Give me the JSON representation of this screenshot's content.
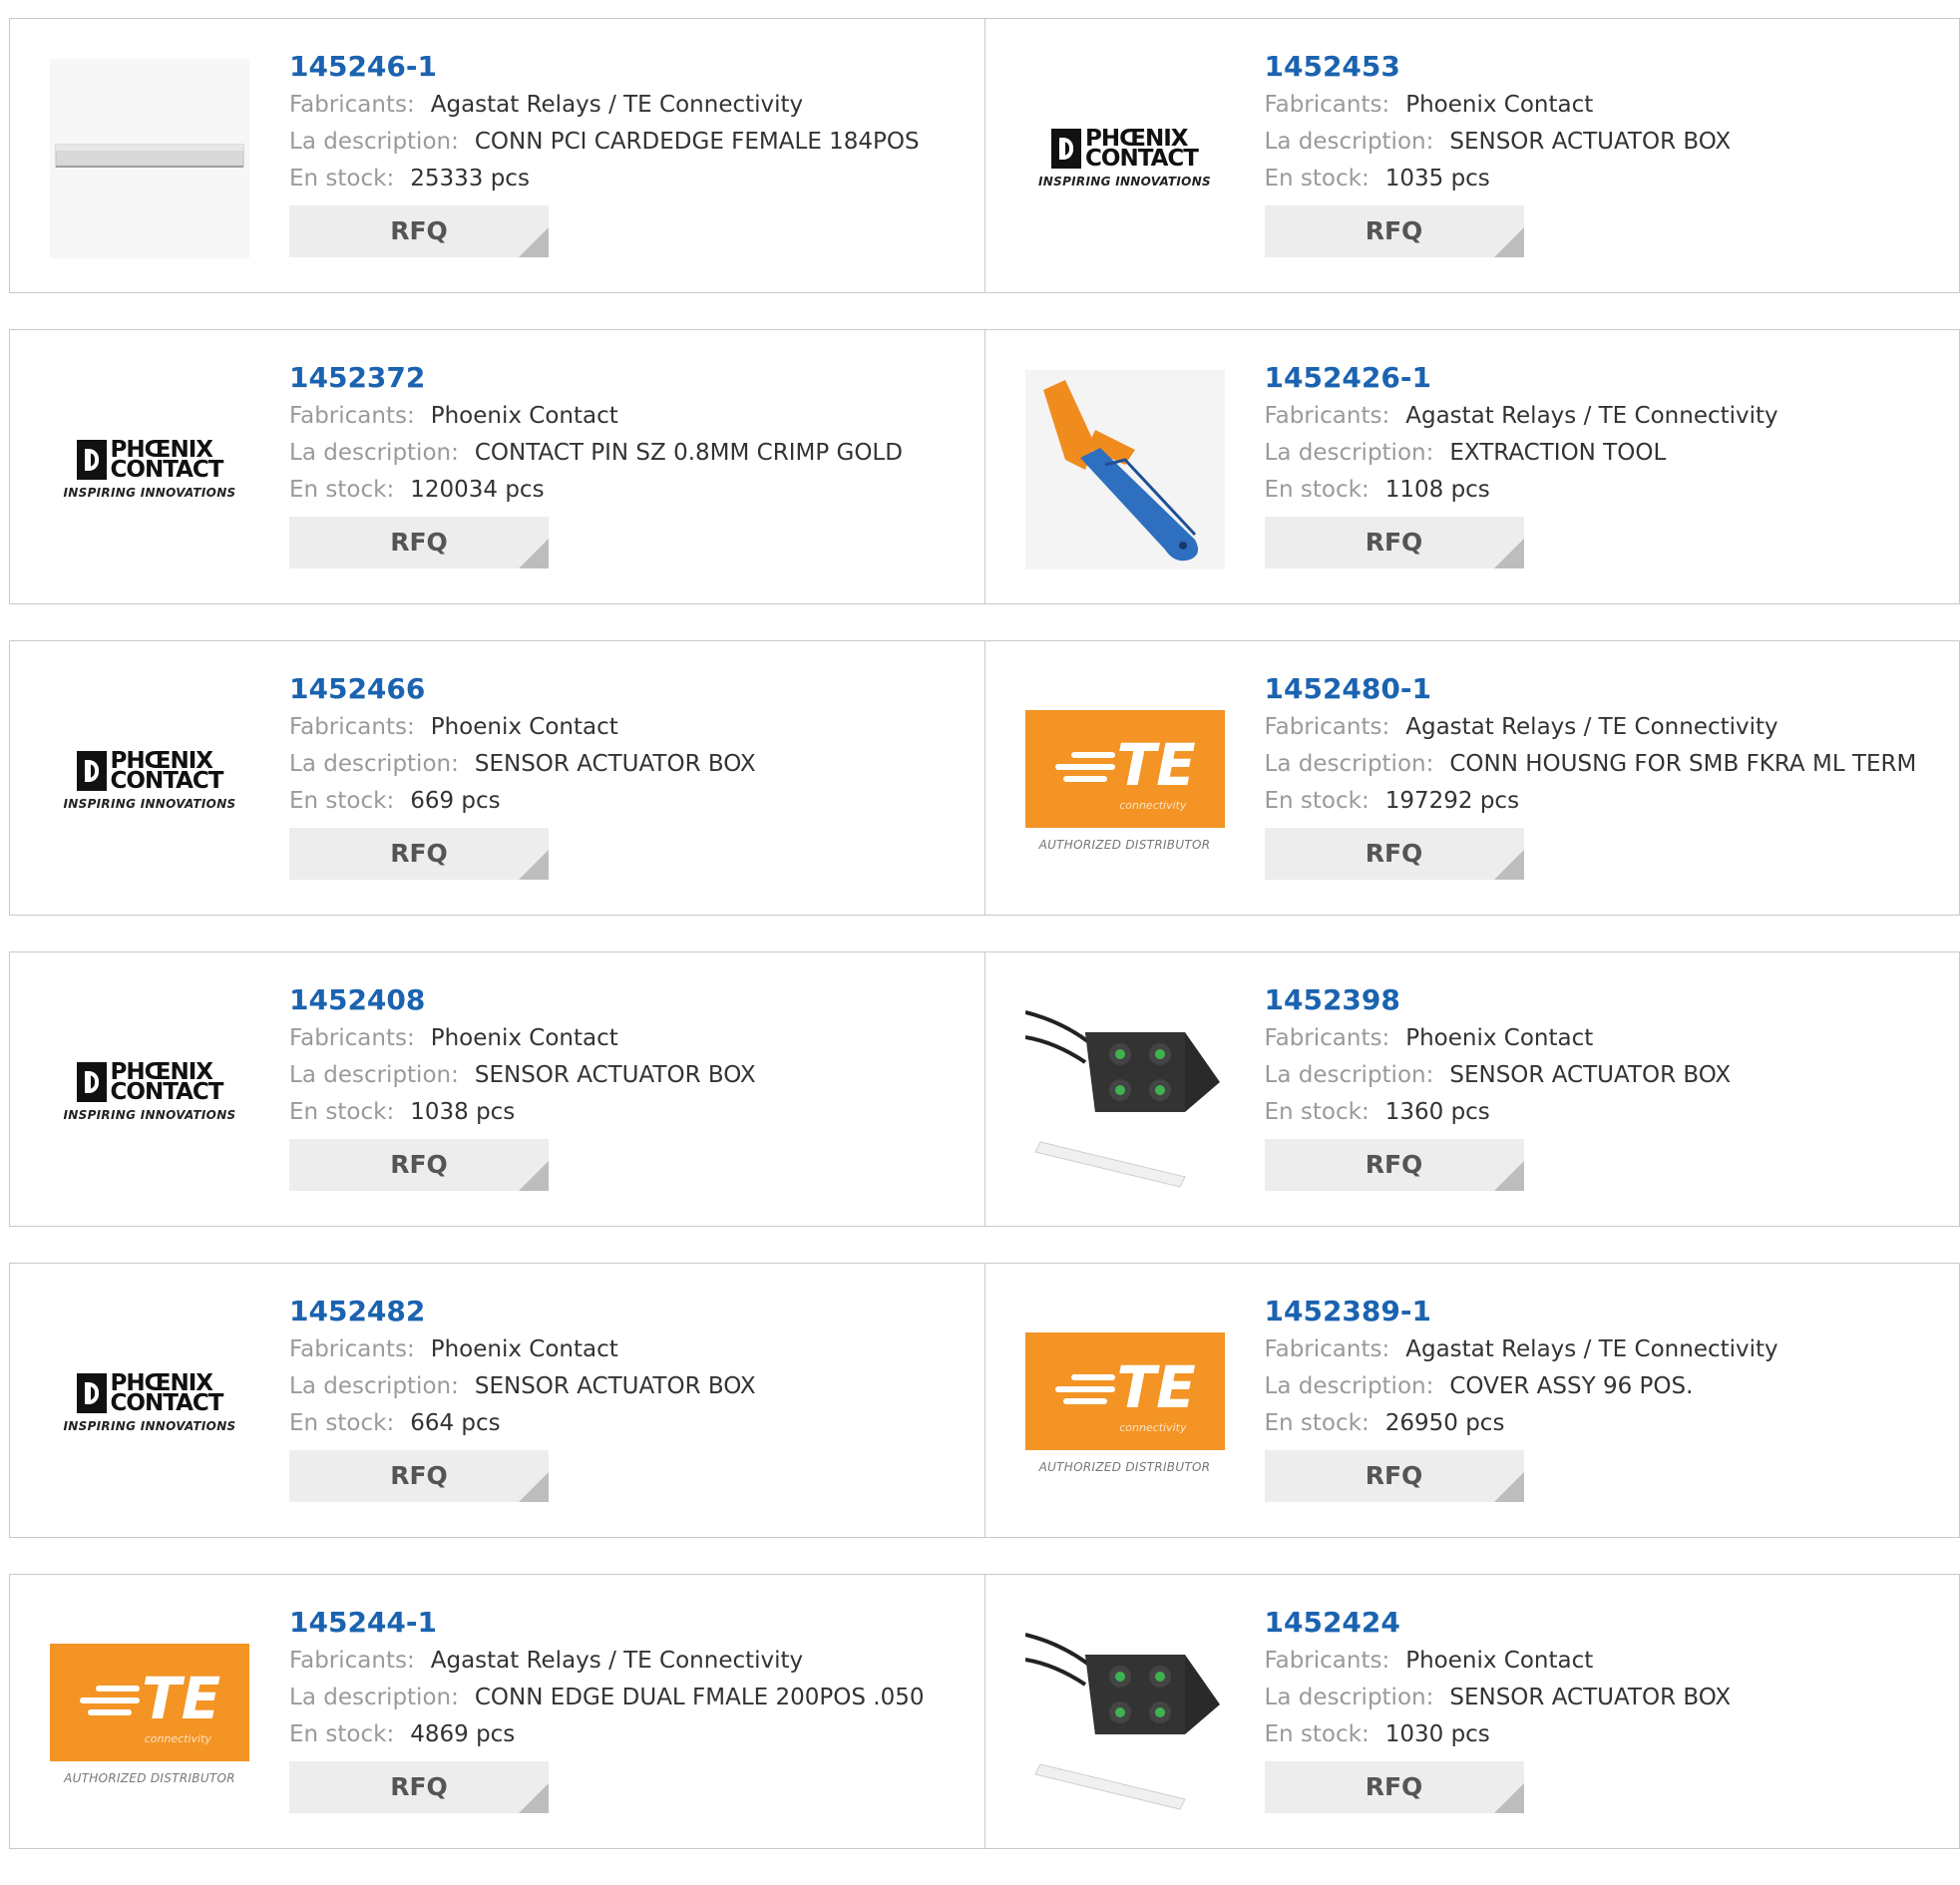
{
  "labels": {
    "manufacturer": "Fabricants:",
    "description": "La description:",
    "stock": "En stock:",
    "rfq": "RFQ"
  },
  "logo_text": {
    "phoenix_line1": "PHŒNIX",
    "phoenix_line2": "CONTACT",
    "phoenix_tagline": "INSPIRING INNOVATIONS",
    "te_letters": "TE",
    "te_sub": "connectivity",
    "te_authorized": "AUTHORIZED DISTRIBUTOR"
  },
  "colors": {
    "part_number": "#1b63b0",
    "te_orange": "#f39425",
    "rfq_bg": "#ededed"
  },
  "products": [
    {
      "part": "145246-1",
      "manufacturer": "Agastat Relays / TE Connectivity",
      "description": "CONN PCI CARDEDGE FEMALE 184POS",
      "stock": "25333 pcs",
      "image": "card-edge-connector-photo"
    },
    {
      "part": "1452453",
      "manufacturer": "Phoenix Contact",
      "description": "SENSOR ACTUATOR BOX",
      "stock": "1035 pcs",
      "image": "phoenix-contact-logo"
    },
    {
      "part": "1452372",
      "manufacturer": "Phoenix Contact",
      "description": "CONTACT PIN SZ 0.8MM CRIMP GOLD",
      "stock": "120034 pcs",
      "image": "phoenix-contact-logo"
    },
    {
      "part": "1452426-1",
      "manufacturer": "Agastat Relays / TE Connectivity",
      "description": "EXTRACTION TOOL",
      "stock": "1108 pcs",
      "image": "extraction-tool-photo"
    },
    {
      "part": "1452466",
      "manufacturer": "Phoenix Contact",
      "description": "SENSOR ACTUATOR BOX",
      "stock": "669 pcs",
      "image": "phoenix-contact-logo"
    },
    {
      "part": "1452480-1",
      "manufacturer": "Agastat Relays / TE Connectivity",
      "description": "CONN HOUSNG FOR SMB FKRA ML TERM",
      "stock": "197292 pcs",
      "image": "te-connectivity-logo"
    },
    {
      "part": "1452408",
      "manufacturer": "Phoenix Contact",
      "description": "SENSOR ACTUATOR BOX",
      "stock": "1038 pcs",
      "image": "phoenix-contact-logo"
    },
    {
      "part": "1452398",
      "manufacturer": "Phoenix Contact",
      "description": "SENSOR ACTUATOR BOX",
      "stock": "1360 pcs",
      "image": "sensor-box-photo"
    },
    {
      "part": "1452482",
      "manufacturer": "Phoenix Contact",
      "description": "SENSOR ACTUATOR BOX",
      "stock": "664 pcs",
      "image": "phoenix-contact-logo"
    },
    {
      "part": "1452389-1",
      "manufacturer": "Agastat Relays / TE Connectivity",
      "description": "COVER ASSY 96 POS.",
      "stock": "26950 pcs",
      "image": "te-connectivity-logo"
    },
    {
      "part": "145244-1",
      "manufacturer": "Agastat Relays / TE Connectivity",
      "description": "CONN EDGE DUAL FMALE 200POS .050",
      "stock": "4869 pcs",
      "image": "te-connectivity-logo"
    },
    {
      "part": "1452424",
      "manufacturer": "Phoenix Contact",
      "description": "SENSOR ACTUATOR BOX",
      "stock": "1030 pcs",
      "image": "sensor-box-photo"
    }
  ]
}
